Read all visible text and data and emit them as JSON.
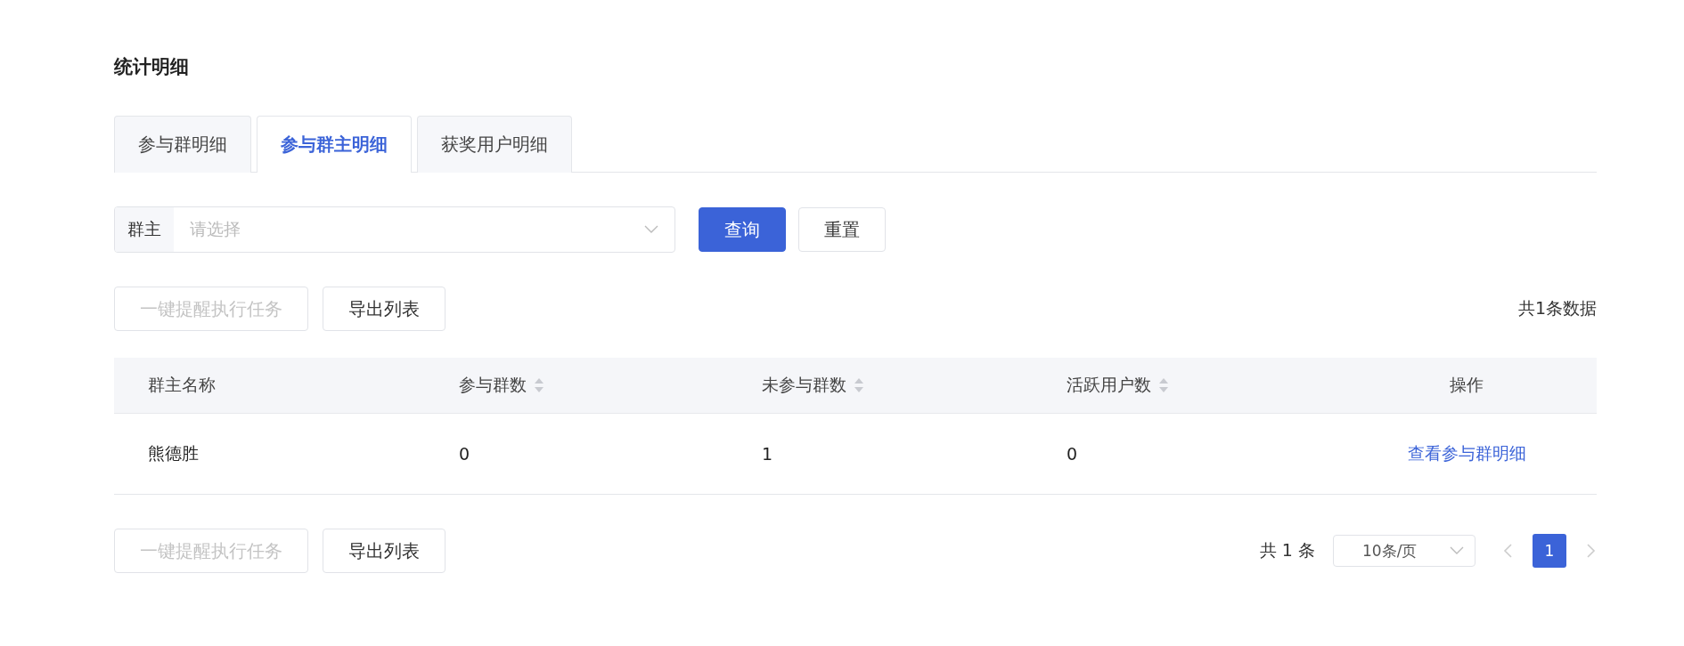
{
  "title": "统计明细",
  "tabs": [
    {
      "label": "参与群明细",
      "selected": false
    },
    {
      "label": "参与群主明细",
      "selected": true
    },
    {
      "label": "获奖用户明细",
      "selected": false
    }
  ],
  "filter": {
    "label": "群主",
    "placeholder": "请选择",
    "buttons": [
      {
        "label": "查询",
        "kind": "primary"
      },
      {
        "label": "重置",
        "kind": "default"
      }
    ]
  },
  "top_actions": [
    {
      "label": "一键提醒执行任务",
      "disabled": true
    },
    {
      "label": "导出列表",
      "disabled": false
    }
  ],
  "total_summary": "共1条数据",
  "table": {
    "columns": [
      {
        "label": "群主名称",
        "kind": "plain"
      },
      {
        "label": "参与群数",
        "kind": "sortable"
      },
      {
        "label": "未参与群数",
        "kind": "sortable"
      },
      {
        "label": "活跃用户数",
        "kind": "sortable"
      },
      {
        "label": "操作",
        "kind": "action"
      }
    ],
    "rows": [
      {
        "cells": [
          "熊德胜",
          "0",
          "1",
          "0"
        ],
        "action": "查看参与群明细"
      }
    ]
  },
  "bottom_actions": [
    {
      "label": "一键提醒执行任务",
      "disabled": true
    },
    {
      "label": "导出列表",
      "disabled": false
    }
  ],
  "pagination": {
    "total": "共 1 条",
    "page_size": "10条/页",
    "pages": [
      {
        "label": "1",
        "selected": true
      }
    ]
  }
}
